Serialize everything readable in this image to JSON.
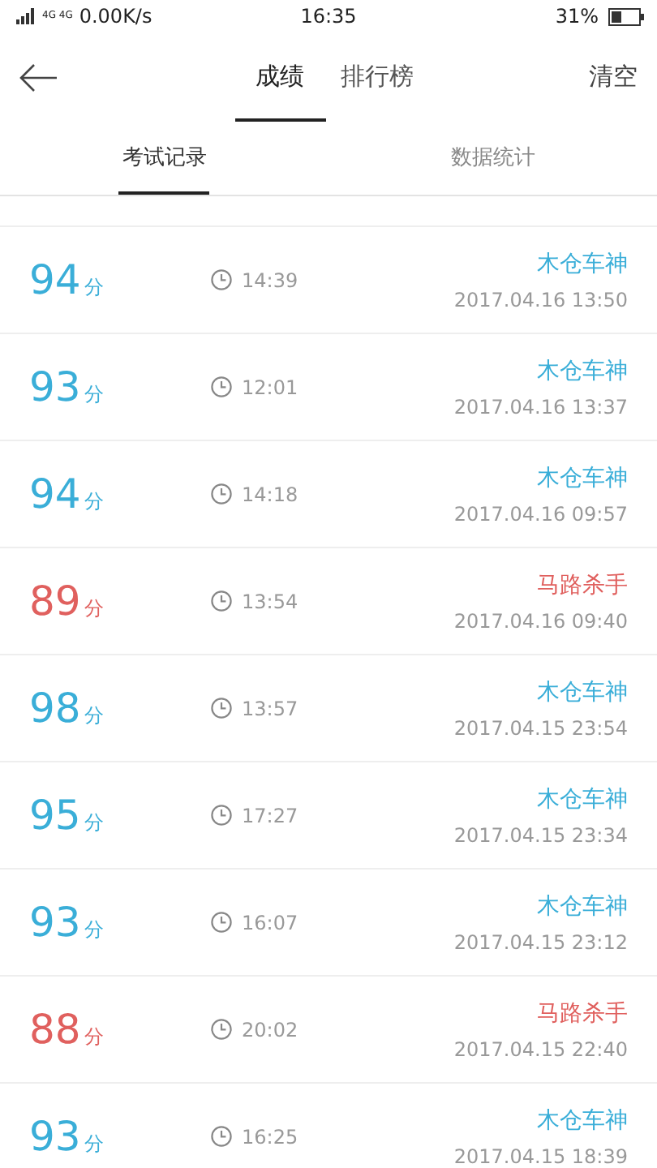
{
  "status_bar": {
    "network": "4G 4G",
    "speed": "0.00K/s",
    "time": "16:35",
    "battery": "31%"
  },
  "header": {
    "tabs": [
      {
        "label": "成绩",
        "selected": true
      },
      {
        "label": "排行榜",
        "selected": false
      }
    ],
    "action": "清空"
  },
  "sub_tabs": [
    {
      "label": "考试记录",
      "selected": true
    },
    {
      "label": "数据统计",
      "selected": false
    }
  ],
  "records": [
    {
      "score": "94",
      "unit": "分",
      "duration": "14:39",
      "title": "木仓车神",
      "date": "2017.04.16 13:50",
      "color": "#3aaed8"
    },
    {
      "score": "93",
      "unit": "分",
      "duration": "12:01",
      "title": "木仓车神",
      "date": "2017.04.16 13:37",
      "color": "#3aaed8"
    },
    {
      "score": "94",
      "unit": "分",
      "duration": "14:18",
      "title": "木仓车神",
      "date": "2017.04.16 09:57",
      "color": "#3aaed8"
    },
    {
      "score": "89",
      "unit": "分",
      "duration": "13:54",
      "title": "马路杀手",
      "date": "2017.04.16 09:40",
      "color": "#e0605e"
    },
    {
      "score": "98",
      "unit": "分",
      "duration": "13:57",
      "title": "木仓车神",
      "date": "2017.04.15 23:54",
      "color": "#3aaed8"
    },
    {
      "score": "95",
      "unit": "分",
      "duration": "17:27",
      "title": "木仓车神",
      "date": "2017.04.15 23:34",
      "color": "#3aaed8"
    },
    {
      "score": "93",
      "unit": "分",
      "duration": "16:07",
      "title": "木仓车神",
      "date": "2017.04.15 23:12",
      "color": "#3aaed8"
    },
    {
      "score": "88",
      "unit": "分",
      "duration": "20:02",
      "title": "马路杀手",
      "date": "2017.04.15 22:40",
      "color": "#e0605e"
    },
    {
      "score": "93",
      "unit": "分",
      "duration": "16:25",
      "title": "木仓车神",
      "date": "2017.04.15 18:39",
      "color": "#3aaed8"
    }
  ]
}
